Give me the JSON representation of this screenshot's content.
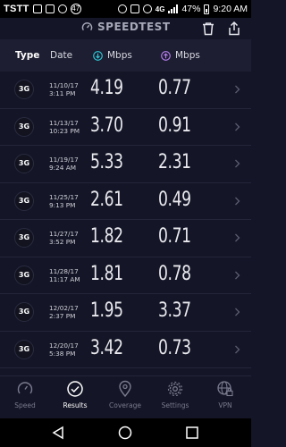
{
  "status_bar": {
    "carrier": "TSTT",
    "badge_count": "47",
    "network": "4G",
    "battery_percent": "47%",
    "time": "9:20 AM"
  },
  "app": {
    "title": "SPEEDTEST"
  },
  "columns": {
    "type": "Type",
    "date": "Date",
    "download_unit": "Mbps",
    "upload_unit": "Mbps"
  },
  "results": [
    {
      "type": "3G",
      "date": "11/10/17",
      "time": "3:11 PM",
      "download": "4.19",
      "upload": "0.77"
    },
    {
      "type": "3G",
      "date": "11/13/17",
      "time": "10:23 PM",
      "download": "3.70",
      "upload": "0.91"
    },
    {
      "type": "3G",
      "date": "11/19/17",
      "time": "9:24 AM",
      "download": "5.33",
      "upload": "2.31"
    },
    {
      "type": "3G",
      "date": "11/25/17",
      "time": "9:13 PM",
      "download": "2.61",
      "upload": "0.49"
    },
    {
      "type": "3G",
      "date": "11/27/17",
      "time": "3:52 PM",
      "download": "1.82",
      "upload": "0.71"
    },
    {
      "type": "3G",
      "date": "11/28/17",
      "time": "11:17 AM",
      "download": "1.81",
      "upload": "0.78"
    },
    {
      "type": "3G",
      "date": "12/02/17",
      "time": "2:37 PM",
      "download": "1.95",
      "upload": "3.37"
    },
    {
      "type": "3G",
      "date": "12/20/17",
      "time": "5:38 PM",
      "download": "3.42",
      "upload": "0.73"
    }
  ],
  "bottom_nav": [
    {
      "label": "Speed",
      "icon": "gauge-icon",
      "active": false
    },
    {
      "label": "Results",
      "icon": "checkmark-circle-icon",
      "active": true
    },
    {
      "label": "Coverage",
      "icon": "map-pin-icon",
      "active": false
    },
    {
      "label": "Settings",
      "icon": "gear-icon",
      "active": false
    },
    {
      "label": "VPN",
      "icon": "globe-lock-icon",
      "active": false
    }
  ],
  "colors": {
    "background": "#141526",
    "download_accent": "#2ec9d6",
    "upload_accent": "#b77ef0"
  }
}
